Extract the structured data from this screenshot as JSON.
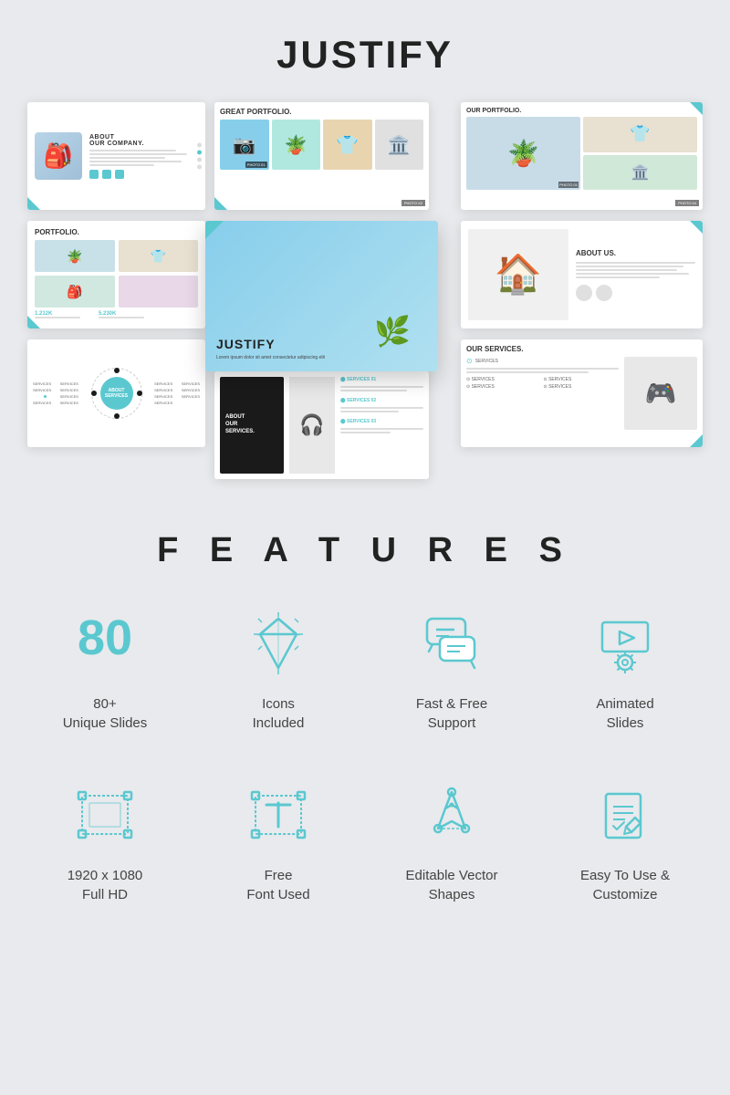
{
  "title": "JUSTIFY",
  "features_title": "F E A T U R E S",
  "features": [
    {
      "id": "unique-slides",
      "icon_type": "number",
      "number": "80",
      "label": "80+\nUnique Slides"
    },
    {
      "id": "icons-included",
      "icon_type": "diamond",
      "label": "Icons\nIncluded"
    },
    {
      "id": "fast-free-support",
      "icon_type": "support",
      "label": "Fast & Free\nSupport"
    },
    {
      "id": "animated-slides",
      "icon_type": "animated",
      "label": "Animated\nSlides"
    },
    {
      "id": "full-hd",
      "icon_type": "fullhd",
      "label": "1920 x 1080\nFull HD"
    },
    {
      "id": "free-font",
      "icon_type": "font",
      "label": "Free\nFont Used"
    },
    {
      "id": "vector-shapes",
      "icon_type": "vector",
      "label": "Editable Vector\nShapes"
    },
    {
      "id": "easy-customize",
      "icon_type": "customize",
      "label": "Easy To Use &\nCustomize"
    }
  ],
  "accent_color": "#5bc8d0",
  "slides": {
    "about_company_title": "ABOUT OUR COMPANY.",
    "portfolio_title": "PORTFOLIO.",
    "great_portfolio_title": "GREAT PORTFOLIO.",
    "our_portfolio_title": "OUR PORTFOLIO.",
    "about_us_title": "ABOUT US.",
    "our_services_title": "OUR SERVICES.",
    "about_services_title": "ABOUT OUR SERVICES.",
    "justify_label": "JUSTIFY"
  }
}
